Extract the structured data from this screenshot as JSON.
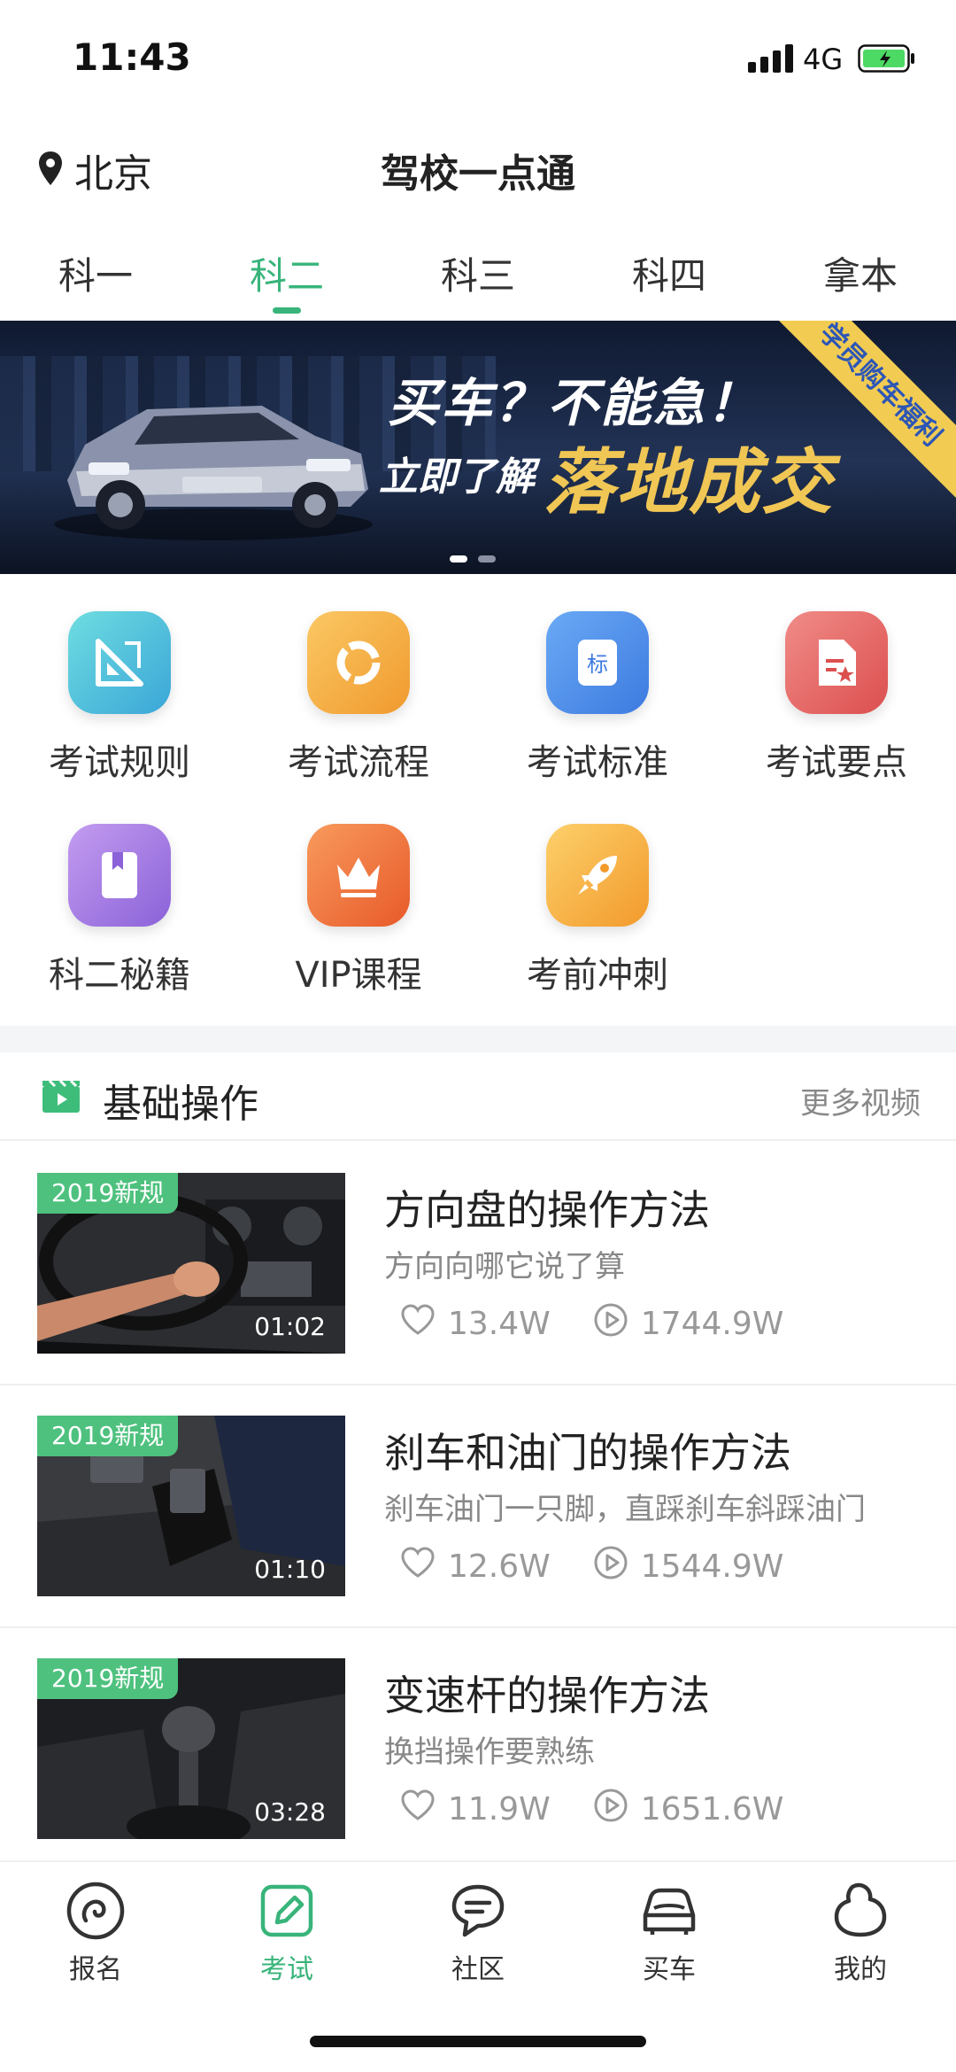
{
  "status_bar": {
    "time": "11:43",
    "network": "4G"
  },
  "header": {
    "location": "北京",
    "title": "驾校一点通"
  },
  "tabs": [
    {
      "label": "科一",
      "active": false
    },
    {
      "label": "科二",
      "active": true
    },
    {
      "label": "科三",
      "active": false
    },
    {
      "label": "科四",
      "active": false
    },
    {
      "label": "拿本",
      "active": false
    }
  ],
  "banner": {
    "line1": "买车？不能急！",
    "line2": "立即了解",
    "line3": "落地成交",
    "ribbon": "学员购车福利",
    "page_count": 2,
    "active_page": 1
  },
  "grid": [
    {
      "label": "考试规则",
      "icon": "ruler-icon",
      "color": "#4fc3d6"
    },
    {
      "label": "考试流程",
      "icon": "cycle-icon",
      "color": "#f5a93b"
    },
    {
      "label": "考试标准",
      "icon": "standard-doc-icon",
      "color": "#4a8fe8"
    },
    {
      "label": "考试要点",
      "icon": "star-doc-icon",
      "color": "#e86462"
    },
    {
      "label": "科二秘籍",
      "icon": "book-icon",
      "color": "#a77fe0"
    },
    {
      "label": "VIP课程",
      "icon": "crown-icon",
      "color": "#f0703a"
    },
    {
      "label": "考前冲刺",
      "icon": "rocket-icon",
      "color": "#f6b63d"
    }
  ],
  "section": {
    "title": "基础操作",
    "more": "更多视频"
  },
  "videos": [
    {
      "badge": "2019新规",
      "duration": "01:02",
      "title": "方向盘的操作方法",
      "subtitle": "方向向哪它说了算",
      "likes": "13.4W",
      "plays": "1744.9W"
    },
    {
      "badge": "2019新规",
      "duration": "01:10",
      "title": "刹车和油门的操作方法",
      "subtitle": "刹车油门一只脚，直踩刹车斜踩油门",
      "likes": "12.6W",
      "plays": "1544.9W"
    },
    {
      "badge": "2019新规",
      "duration": "03:28",
      "title": "变速杆的操作方法",
      "subtitle": "换挡操作要熟练",
      "likes": "11.9W",
      "plays": "1651.6W"
    }
  ],
  "bottom_nav": [
    {
      "label": "报名",
      "icon": "signup-icon",
      "active": false
    },
    {
      "label": "考试",
      "icon": "exam-edit-icon",
      "active": true
    },
    {
      "label": "社区",
      "icon": "community-chat-icon",
      "active": false
    },
    {
      "label": "买车",
      "icon": "car-icon",
      "active": false
    },
    {
      "label": "我的",
      "icon": "profile-icon",
      "active": false
    }
  ],
  "colors": {
    "accent": "#38b47a",
    "badge": "#4ec17e",
    "banner_highlight": "#f0c654"
  }
}
